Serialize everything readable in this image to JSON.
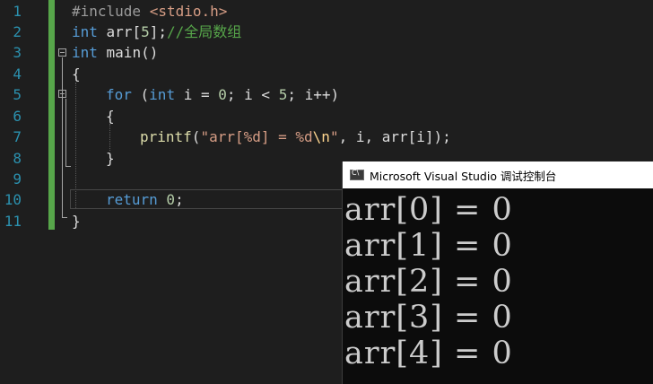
{
  "editor": {
    "line_numbers": [
      "1",
      "2",
      "3",
      "4",
      "5",
      "6",
      "7",
      "8",
      "9",
      "10",
      "11"
    ],
    "lines": {
      "l1_directive": "#include",
      "l1_header": "<stdio.h>",
      "l2_type": "int",
      "l2_decl": " arr[",
      "l2_size": "5",
      "l2_close": "];",
      "l2_comment": "//全局数组",
      "l3_type": "int",
      "l3_func": " main()",
      "l4_brace": "{",
      "l5_for": "for",
      "l5_open": " (",
      "l5_int": "int",
      "l5_mid": " i = ",
      "l5_zero": "0",
      "l5_cond": "; i < ",
      "l5_five": "5",
      "l5_end": "; i++)",
      "l6_brace": "{",
      "l7_fn": "printf",
      "l7_paren": "(",
      "l7_str1": "\"arr[%d] = %d",
      "l7_esc": "\\n",
      "l7_str2": "\"",
      "l7_args": ", i, arr[i]);",
      "l8_brace": "}",
      "l10_return": "return",
      "l10_zero": " 0",
      "l10_semi": ";",
      "l11_brace": "}"
    }
  },
  "console": {
    "title": "Microsoft Visual Studio 调试控制台",
    "icon": "console-app-icon",
    "output": [
      "arr[0] = 0",
      "arr[1] = 0",
      "arr[2] = 0",
      "arr[3] = 0",
      "arr[4] = 0"
    ]
  },
  "colors": {
    "keyword": "#569cd6",
    "comment": "#57a64a",
    "string": "#d69d85",
    "line_number": "#2b91af",
    "background": "#1e1e1e"
  }
}
